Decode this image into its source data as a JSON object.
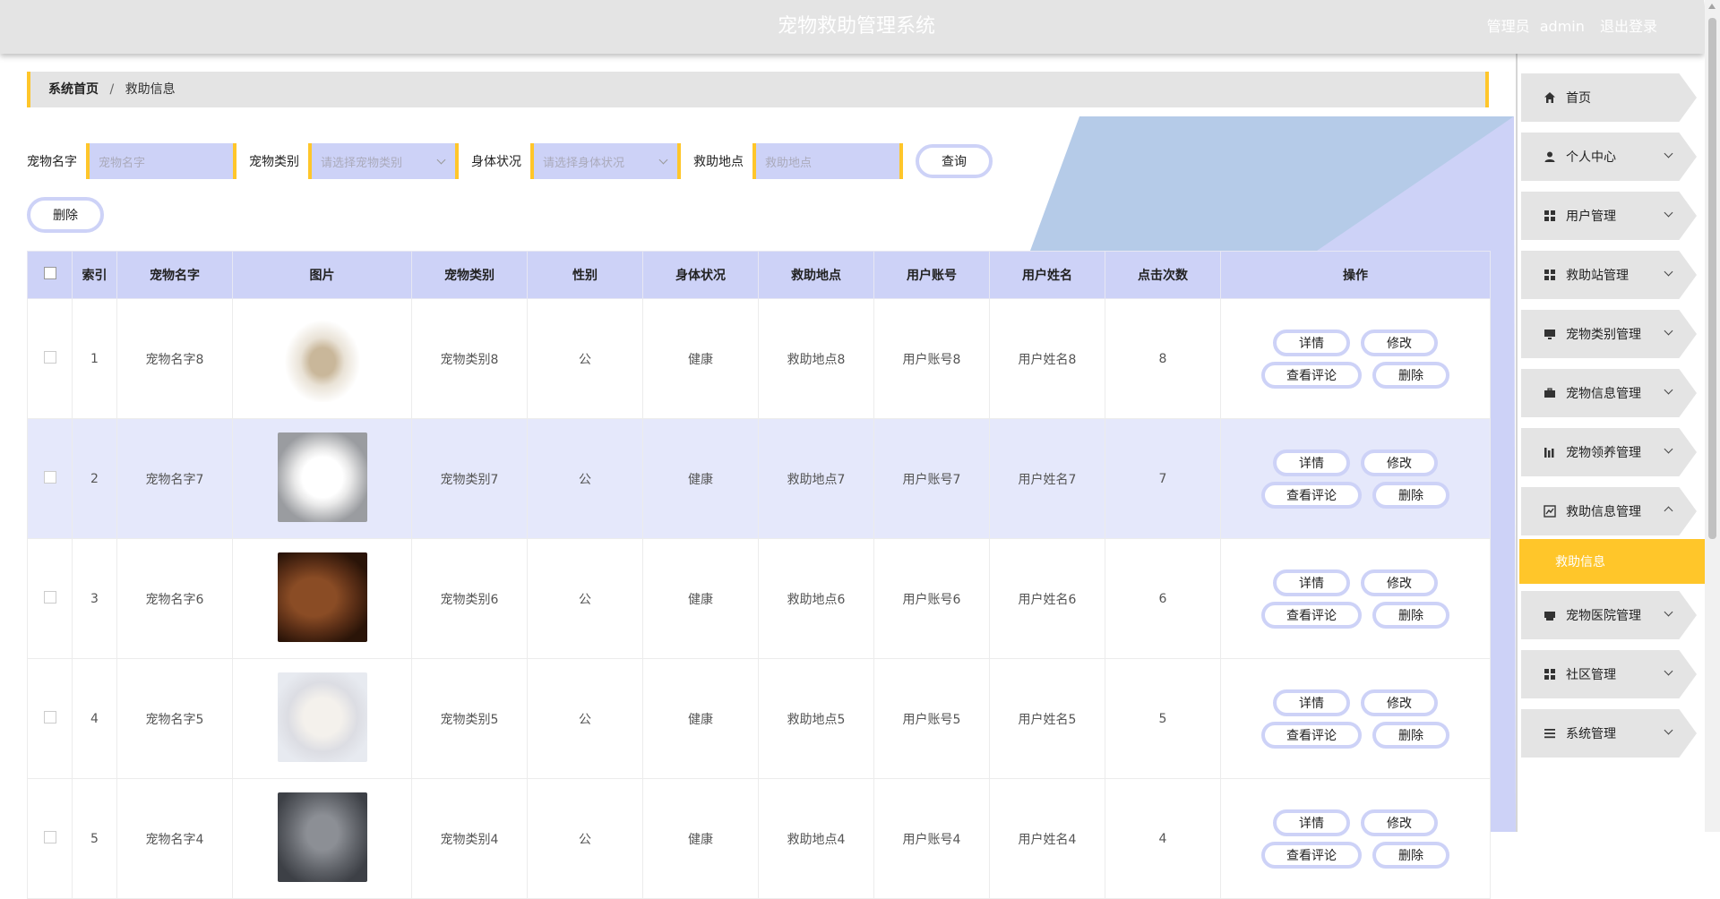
{
  "header": {
    "title": "宠物救助管理系统",
    "role": "管理员",
    "username": "admin",
    "logout": "退出登录"
  },
  "breadcrumb": {
    "home": "系统首页",
    "separator": "/",
    "current": "救助信息"
  },
  "search": {
    "pet_name_label": "宠物名字",
    "pet_name_placeholder": "宠物名字",
    "pet_type_label": "宠物类别",
    "pet_type_placeholder": "请选择宠物类别",
    "health_label": "身体状况",
    "health_placeholder": "请选择身体状况",
    "location_label": "救助地点",
    "location_placeholder": "救助地点",
    "query_button": "查询",
    "delete_button": "删除"
  },
  "table": {
    "columns": [
      "索引",
      "宠物名字",
      "图片",
      "宠物类别",
      "性别",
      "身体状况",
      "救助地点",
      "用户账号",
      "用户姓名",
      "点击次数",
      "操作"
    ],
    "rows": [
      {
        "index": "1",
        "name": "宠物名字8",
        "image": "rabbit-photo",
        "type": "宠物类别8",
        "gender": "公",
        "health": "健康",
        "location": "救助地点8",
        "account": "用户账号8",
        "username": "用户姓名8",
        "clicks": "8"
      },
      {
        "index": "2",
        "name": "宠物名字7",
        "image": "white-pomeranian-photo",
        "type": "宠物类别7",
        "gender": "公",
        "health": "健康",
        "location": "救助地点7",
        "account": "用户账号7",
        "username": "用户姓名7",
        "clicks": "7"
      },
      {
        "index": "3",
        "name": "宠物名字6",
        "image": "dog-and-kitten-photo",
        "type": "宠物类别6",
        "gender": "公",
        "health": "健康",
        "location": "救助地点6",
        "account": "用户账号6",
        "username": "用户姓名6",
        "clicks": "6"
      },
      {
        "index": "4",
        "name": "宠物名字5",
        "image": "white-kitten-photo",
        "type": "宠物类别5",
        "gender": "公",
        "health": "健康",
        "location": "救助地点5",
        "account": "用户账号5",
        "username": "用户姓名5",
        "clicks": "5"
      },
      {
        "index": "5",
        "name": "宠物名字4",
        "image": "gray-cat-photo",
        "type": "宠物类别4",
        "gender": "公",
        "health": "健康",
        "location": "救助地点4",
        "account": "用户账号4",
        "username": "用户姓名4",
        "clicks": "4"
      }
    ],
    "actions": {
      "detail": "详情",
      "edit": "修改",
      "comments": "查看评论",
      "delete": "删除"
    }
  },
  "sidebar": {
    "items": [
      {
        "label": "首页",
        "icon": "home-icon"
      },
      {
        "label": "个人中心",
        "icon": "user-icon"
      },
      {
        "label": "用户管理",
        "icon": "grid-icon"
      },
      {
        "label": "救助站管理",
        "icon": "grid-icon"
      },
      {
        "label": "宠物类别管理",
        "icon": "monitor-icon"
      },
      {
        "label": "宠物信息管理",
        "icon": "briefcase-icon"
      },
      {
        "label": "宠物领养管理",
        "icon": "chart-bar-icon"
      },
      {
        "label": "救助信息管理",
        "icon": "chart-line-icon"
      },
      {
        "label": "宠物医院管理",
        "icon": "printer-icon"
      },
      {
        "label": "社区管理",
        "icon": "grid-icon"
      },
      {
        "label": "系统管理",
        "icon": "menu-icon"
      }
    ],
    "active_sub": "救助信息"
  },
  "colors": {
    "accent_yellow": "#ffc62a",
    "lavender": "#cdd2f7",
    "header_gray": "#e4e4e4",
    "row_highlight": "#e5e8fb"
  }
}
